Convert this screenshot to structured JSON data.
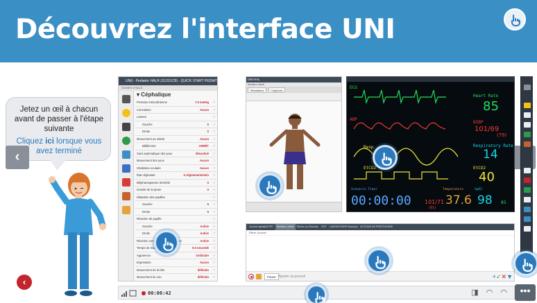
{
  "header": {
    "title": "Découvrez l'interface UNI"
  },
  "bubble": {
    "text": "Jetez un œil à chacun avant de passer à l'étape suivante",
    "link_prefix": "Cliquez ",
    "link_bold": "ici",
    "link_suffix": " lorsque vous avez terminé"
  },
  "nav": {
    "prev_glyph": "‹",
    "next_glyph": "›",
    "back_glyph": "‹",
    "more_glyph": "•••"
  },
  "left_panel": {
    "window_title": "UNI) - Pediatric HAL® (S1201CB) - QUICK START PEDIAT",
    "subheader": "SIGNES VITAUX",
    "section": "Céphalique",
    "rows": [
      {
        "label": "Pression intracrânienne",
        "value": "7.5 mmHg",
        "indent": false
      },
      {
        "label": "Convulsion",
        "value": "Aucun",
        "indent": false
      },
      {
        "label": "Larmes",
        "value": "",
        "indent": false
      },
      {
        "label": "Gauche",
        "value": "0",
        "indent": true
      },
      {
        "label": "Droite",
        "value": "0",
        "indent": true
      },
      {
        "label": "Mouvement au ralenti",
        "value": "Aucun",
        "indent": false
      },
      {
        "label": "Bâillement",
        "value": "ARRÊT",
        "indent": true
      },
      {
        "label": "Suivi automatique des yeux",
        "value": "désactivé",
        "indent": false
      },
      {
        "label": "Mouvement des yeux",
        "value": "Aucun",
        "indent": false
      },
      {
        "label": "Strabisme oculaire",
        "value": "Aucun",
        "indent": false
      },
      {
        "label": "État clignotant",
        "value": "5 clignements/min",
        "indent": false
      },
      {
        "label": "Blépharospasme Sévérité",
        "value": "0",
        "indent": false
      },
      {
        "label": "Gravité de la ptose",
        "value": "0",
        "indent": false
      },
      {
        "label": "Dilatation des pupilles",
        "value": "",
        "indent": false
      },
      {
        "label": "Gauche",
        "value": "5",
        "indent": true
      },
      {
        "label": "Droite",
        "value": "5",
        "indent": true
      },
      {
        "label": "Réaction de pupille",
        "value": "",
        "indent": false
      },
      {
        "label": "Gauche",
        "value": "Active",
        "indent": true
      },
      {
        "label": "Droite",
        "value": "Active",
        "indent": true
      },
      {
        "label": "Réaction consensuelle à la lumière",
        "value": "Active",
        "indent": false
      },
      {
        "label": "Temps de réaction pupilles",
        "value": "0.5 seconde",
        "indent": false
      },
      {
        "label": "Apparence",
        "value": "Ordinaire",
        "indent": false
      },
      {
        "label": "Expression",
        "value": "Aucun",
        "indent": false
      },
      {
        "label": "Mouvement de la tête",
        "value": "défendu",
        "indent": false
      },
      {
        "label": "Mouvement du cou",
        "value": "défendu",
        "indent": false
      }
    ]
  },
  "mid_panel": {
    "window_title": "UNI HAL",
    "subheader": "Moniteur virtuel",
    "tabs": [
      "Simulateur",
      "Capteurs"
    ]
  },
  "monitor": {
    "ecg_label": "ECG",
    "abp_label": "ABP",
    "resp_label": "Resp",
    "etco2_label": "EtCO2",
    "hr_label": "Heart Rate",
    "hr_value": "85",
    "bp_label": "NIBP",
    "bp_value": "101/69",
    "bp_mean": "(79)",
    "rr_label": "Respiratory Rate",
    "rr_value": "14",
    "etco2_value_label": "EtCO2",
    "etco2_value": "40",
    "timer_label": "Scenario Timer",
    "timer_value": "00:00:00",
    "nibp_bottom": "101/71",
    "nibp_bottom_mean": "(81)",
    "temp_label": "Temperature",
    "temp_value": "37.6",
    "spo2_label": "SpO2",
    "spo2_value": "98",
    "spo2_extra": "85"
  },
  "log_panel": {
    "tabs": [
      "Journal rapide",
      "QCPR2",
      "Moniteur virtuel",
      "Tâches du",
      "Entrants",
      "SCP",
      "LABORATOIRE",
      "Sessions",
      "ACTIONS DE PRESTATAIRE"
    ],
    "active_tab_index": 2,
    "subheader": "Filtrer Journal",
    "pause_label": "Pause",
    "input_placeholder": "Ajouter au journal",
    "actions": "+ ✓ ✕ ▼"
  },
  "bottom_bar": {
    "timer": "00:06:42"
  },
  "colors": {
    "header_blue": "#3a8fc5",
    "hotspot_blue": "#2b79bd",
    "alert_red": "#c4242c",
    "monitor_green": "#22e05a",
    "monitor_cyan": "#16d7e6",
    "monitor_yellow": "#f0e63a",
    "monitor_red": "#ff3b30"
  }
}
